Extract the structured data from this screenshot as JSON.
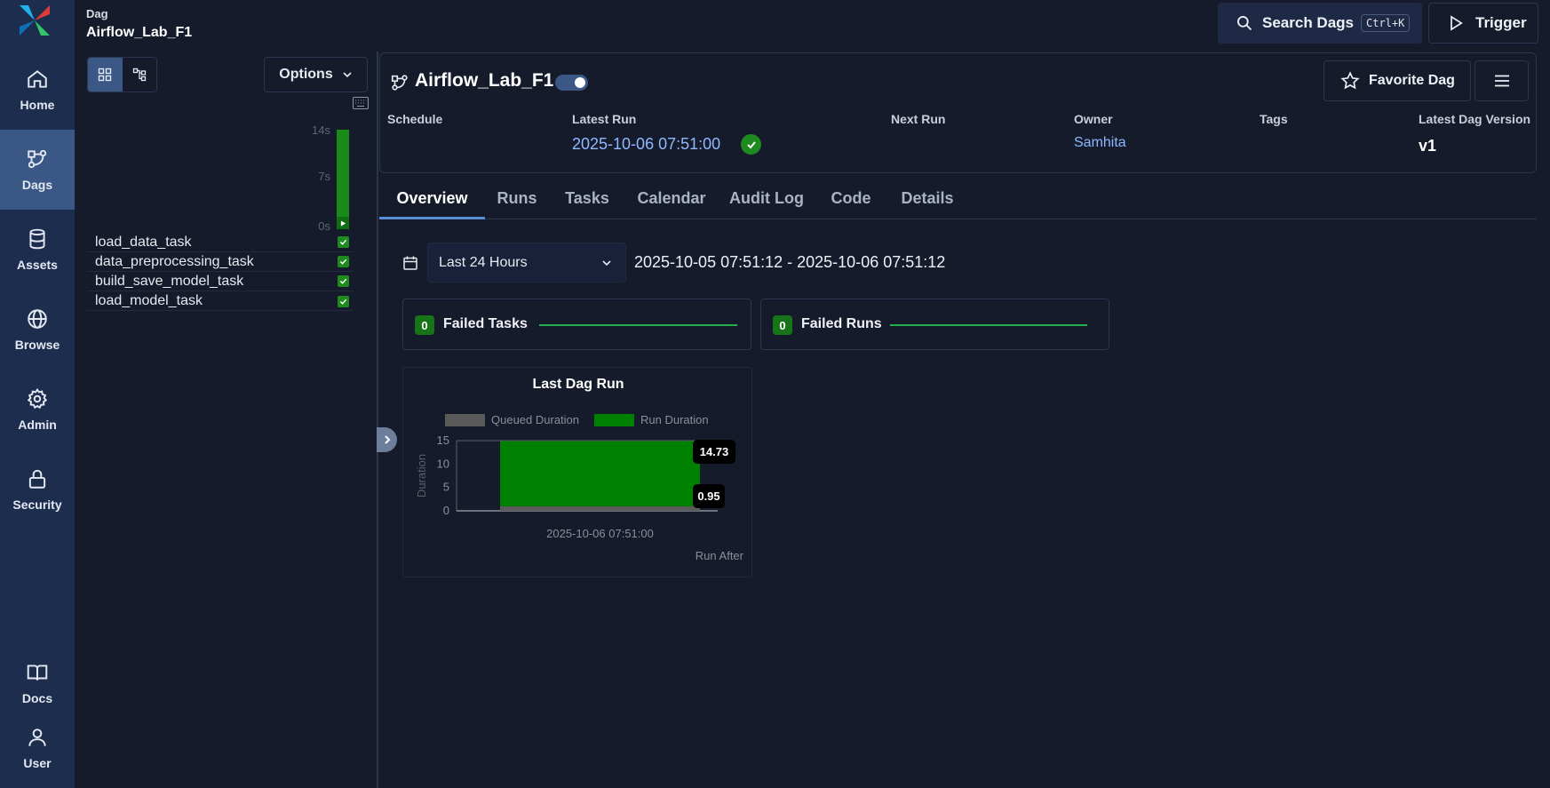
{
  "nav": {
    "items": [
      {
        "label": "Home"
      },
      {
        "label": "Dags"
      },
      {
        "label": "Assets"
      },
      {
        "label": "Browse"
      },
      {
        "label": "Admin"
      },
      {
        "label": "Security"
      },
      {
        "label": "Docs"
      },
      {
        "label": "User"
      }
    ]
  },
  "header": {
    "breadcrumb_label": "Dag",
    "breadcrumb_dag": "Airflow_Lab_F1",
    "search_label": "Search Dags",
    "search_shortcut": "Ctrl+K",
    "trigger_label": "Trigger"
  },
  "grid": {
    "options_label": "Options",
    "y_ticks": [
      "14s",
      "7s",
      "0s"
    ],
    "tasks": [
      {
        "name": "load_data_task",
        "status": "success"
      },
      {
        "name": "data_preprocessing_task",
        "status": "success"
      },
      {
        "name": "build_save_model_task",
        "status": "success"
      },
      {
        "name": "load_model_task",
        "status": "success"
      }
    ],
    "run_bar_fill": 1.0,
    "run_bar_color": "#1a8a1a"
  },
  "dag": {
    "title": "Airflow_Lab_F1",
    "favorite_label": "Favorite Dag",
    "meta": {
      "schedule_label": "Schedule",
      "latest_run_label": "Latest Run",
      "latest_run_value": "2025-10-06 07:51:00",
      "next_run_label": "Next Run",
      "owner_label": "Owner",
      "owner_value": "Samhita",
      "tags_label": "Tags",
      "version_label": "Latest Dag Version",
      "version_value": "v1"
    }
  },
  "tabs": [
    "Overview",
    "Runs",
    "Tasks",
    "Calendar",
    "Audit Log",
    "Code",
    "Details"
  ],
  "overview": {
    "range_option": "Last 24 Hours",
    "range_text": "2025-10-05 07:51:12 - 2025-10-06 07:51:12",
    "failed_tasks": {
      "count": "0",
      "label": "Failed Tasks"
    },
    "failed_runs": {
      "count": "0",
      "label": "Failed Runs"
    }
  },
  "colors": {
    "accent": "#3a5785",
    "success": "#1f8a1f",
    "link": "#8fb8ff",
    "queued": "#5a5a5a",
    "run": "#008000"
  },
  "chart_data": {
    "type": "bar",
    "title": "Last Dag Run",
    "xlabel": "Run After",
    "ylabel": "Duration",
    "categories": [
      "2025-10-06 07:51:00"
    ],
    "series": [
      {
        "name": "Queued Duration",
        "values": [
          0.95
        ],
        "color": "#5a5a5a"
      },
      {
        "name": "Run Duration",
        "values": [
          14.73
        ],
        "color": "#008000"
      }
    ],
    "data_labels": [
      "14.73",
      "0.95"
    ],
    "y_ticks": [
      0,
      5,
      10,
      15
    ],
    "ylim": [
      0,
      15
    ],
    "legend": "top"
  }
}
